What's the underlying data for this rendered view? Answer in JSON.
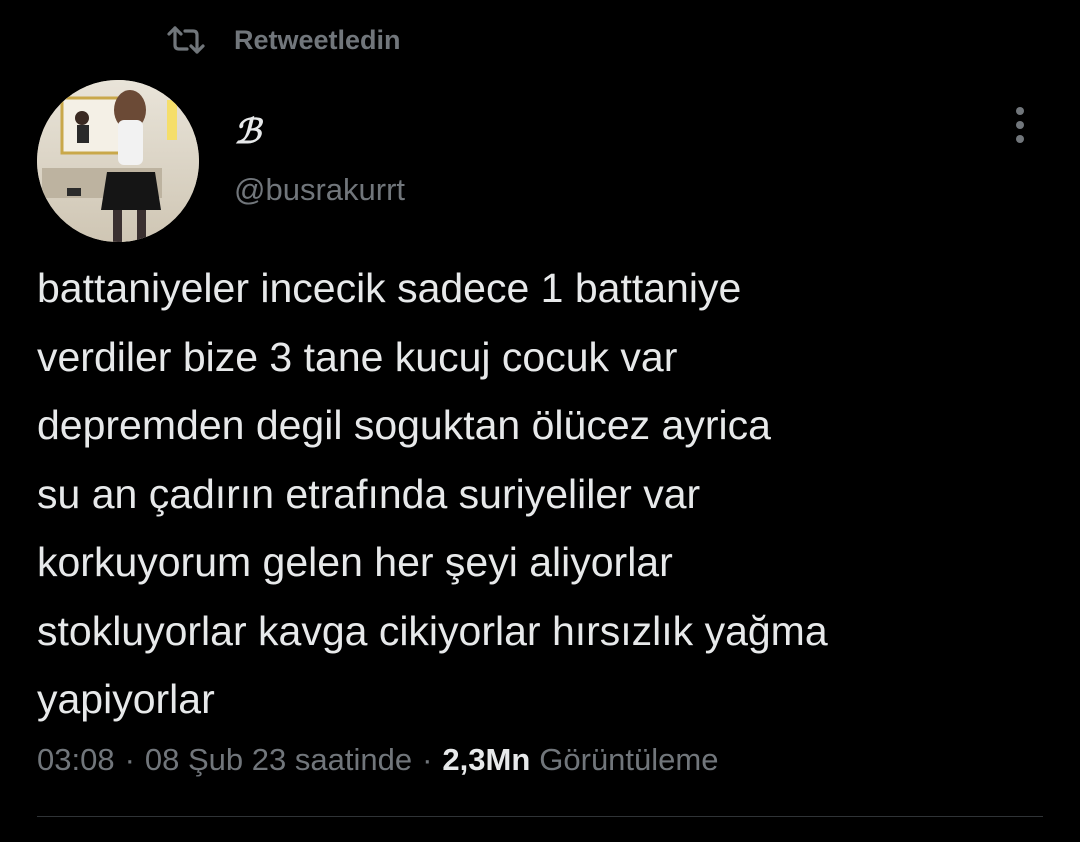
{
  "retweet": {
    "label": "Retweetledin",
    "icon": "retweet-icon"
  },
  "author": {
    "display_name": "ℬ",
    "handle": "@busrakurrt",
    "avatar_icon": "avatar-photo"
  },
  "more_icon": "more-vertical-icon",
  "tweet": {
    "text": "battaniyeler incecik sadece 1 battaniye\nverdiler bize 3 tane kucuj cocuk var\ndepremden degil soguktan ölücez ayrica\nsu an çadırın etrafında suriyeliler var\nkorkuyorum gelen her şeyi aliyorlar\nstokluyorlar kavga cikiyorlar hırsızlık yağma\nyapiyorlar"
  },
  "meta": {
    "time": "03:08",
    "separator": "·",
    "date": "08 Şub 23 saatinde",
    "views_count": "2,3Mn",
    "views_label": "Görüntüleme"
  },
  "colors": {
    "background": "#000000",
    "primary_text": "#e7e9ea",
    "secondary_text": "#71767b",
    "divider": "#2f3336"
  }
}
